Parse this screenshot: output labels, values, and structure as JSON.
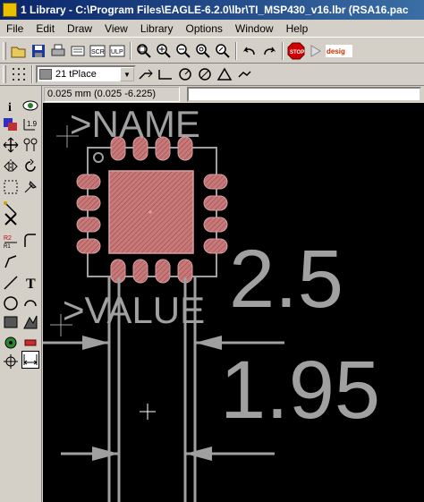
{
  "window": {
    "title": "1 Library - C:\\Program Files\\EAGLE-6.2.0\\lbr\\TI_MSP430_v16.lbr (RSA16.pac"
  },
  "menu": [
    "File",
    "Edit",
    "Draw",
    "View",
    "Library",
    "Options",
    "Window",
    "Help"
  ],
  "toolbar": {
    "layer_value": "21 tPlace",
    "layer_color": "#8c8c8c",
    "icons": [
      "open-icon",
      "save-icon",
      "print-icon",
      "cam-icon",
      "scr-icon",
      "ulp-icon",
      "zoom-fit-icon",
      "zoom-in-icon",
      "zoom-out-icon",
      "zoom-redraw-icon",
      "zoom-select-icon",
      "undo-icon",
      "redo-icon",
      "stop-icon",
      "go-icon",
      "design-link-icon"
    ]
  },
  "coord": {
    "readout": "0.025 mm (0.025 -6.225)"
  },
  "canvas": {
    "name_label": ">NAME",
    "value_label": ">VALUE",
    "dim_large": "2.5",
    "dim_small": "1.95",
    "colors": {
      "background": "#000000",
      "pad": "#c87878",
      "outline": "#a0a0a0"
    }
  }
}
